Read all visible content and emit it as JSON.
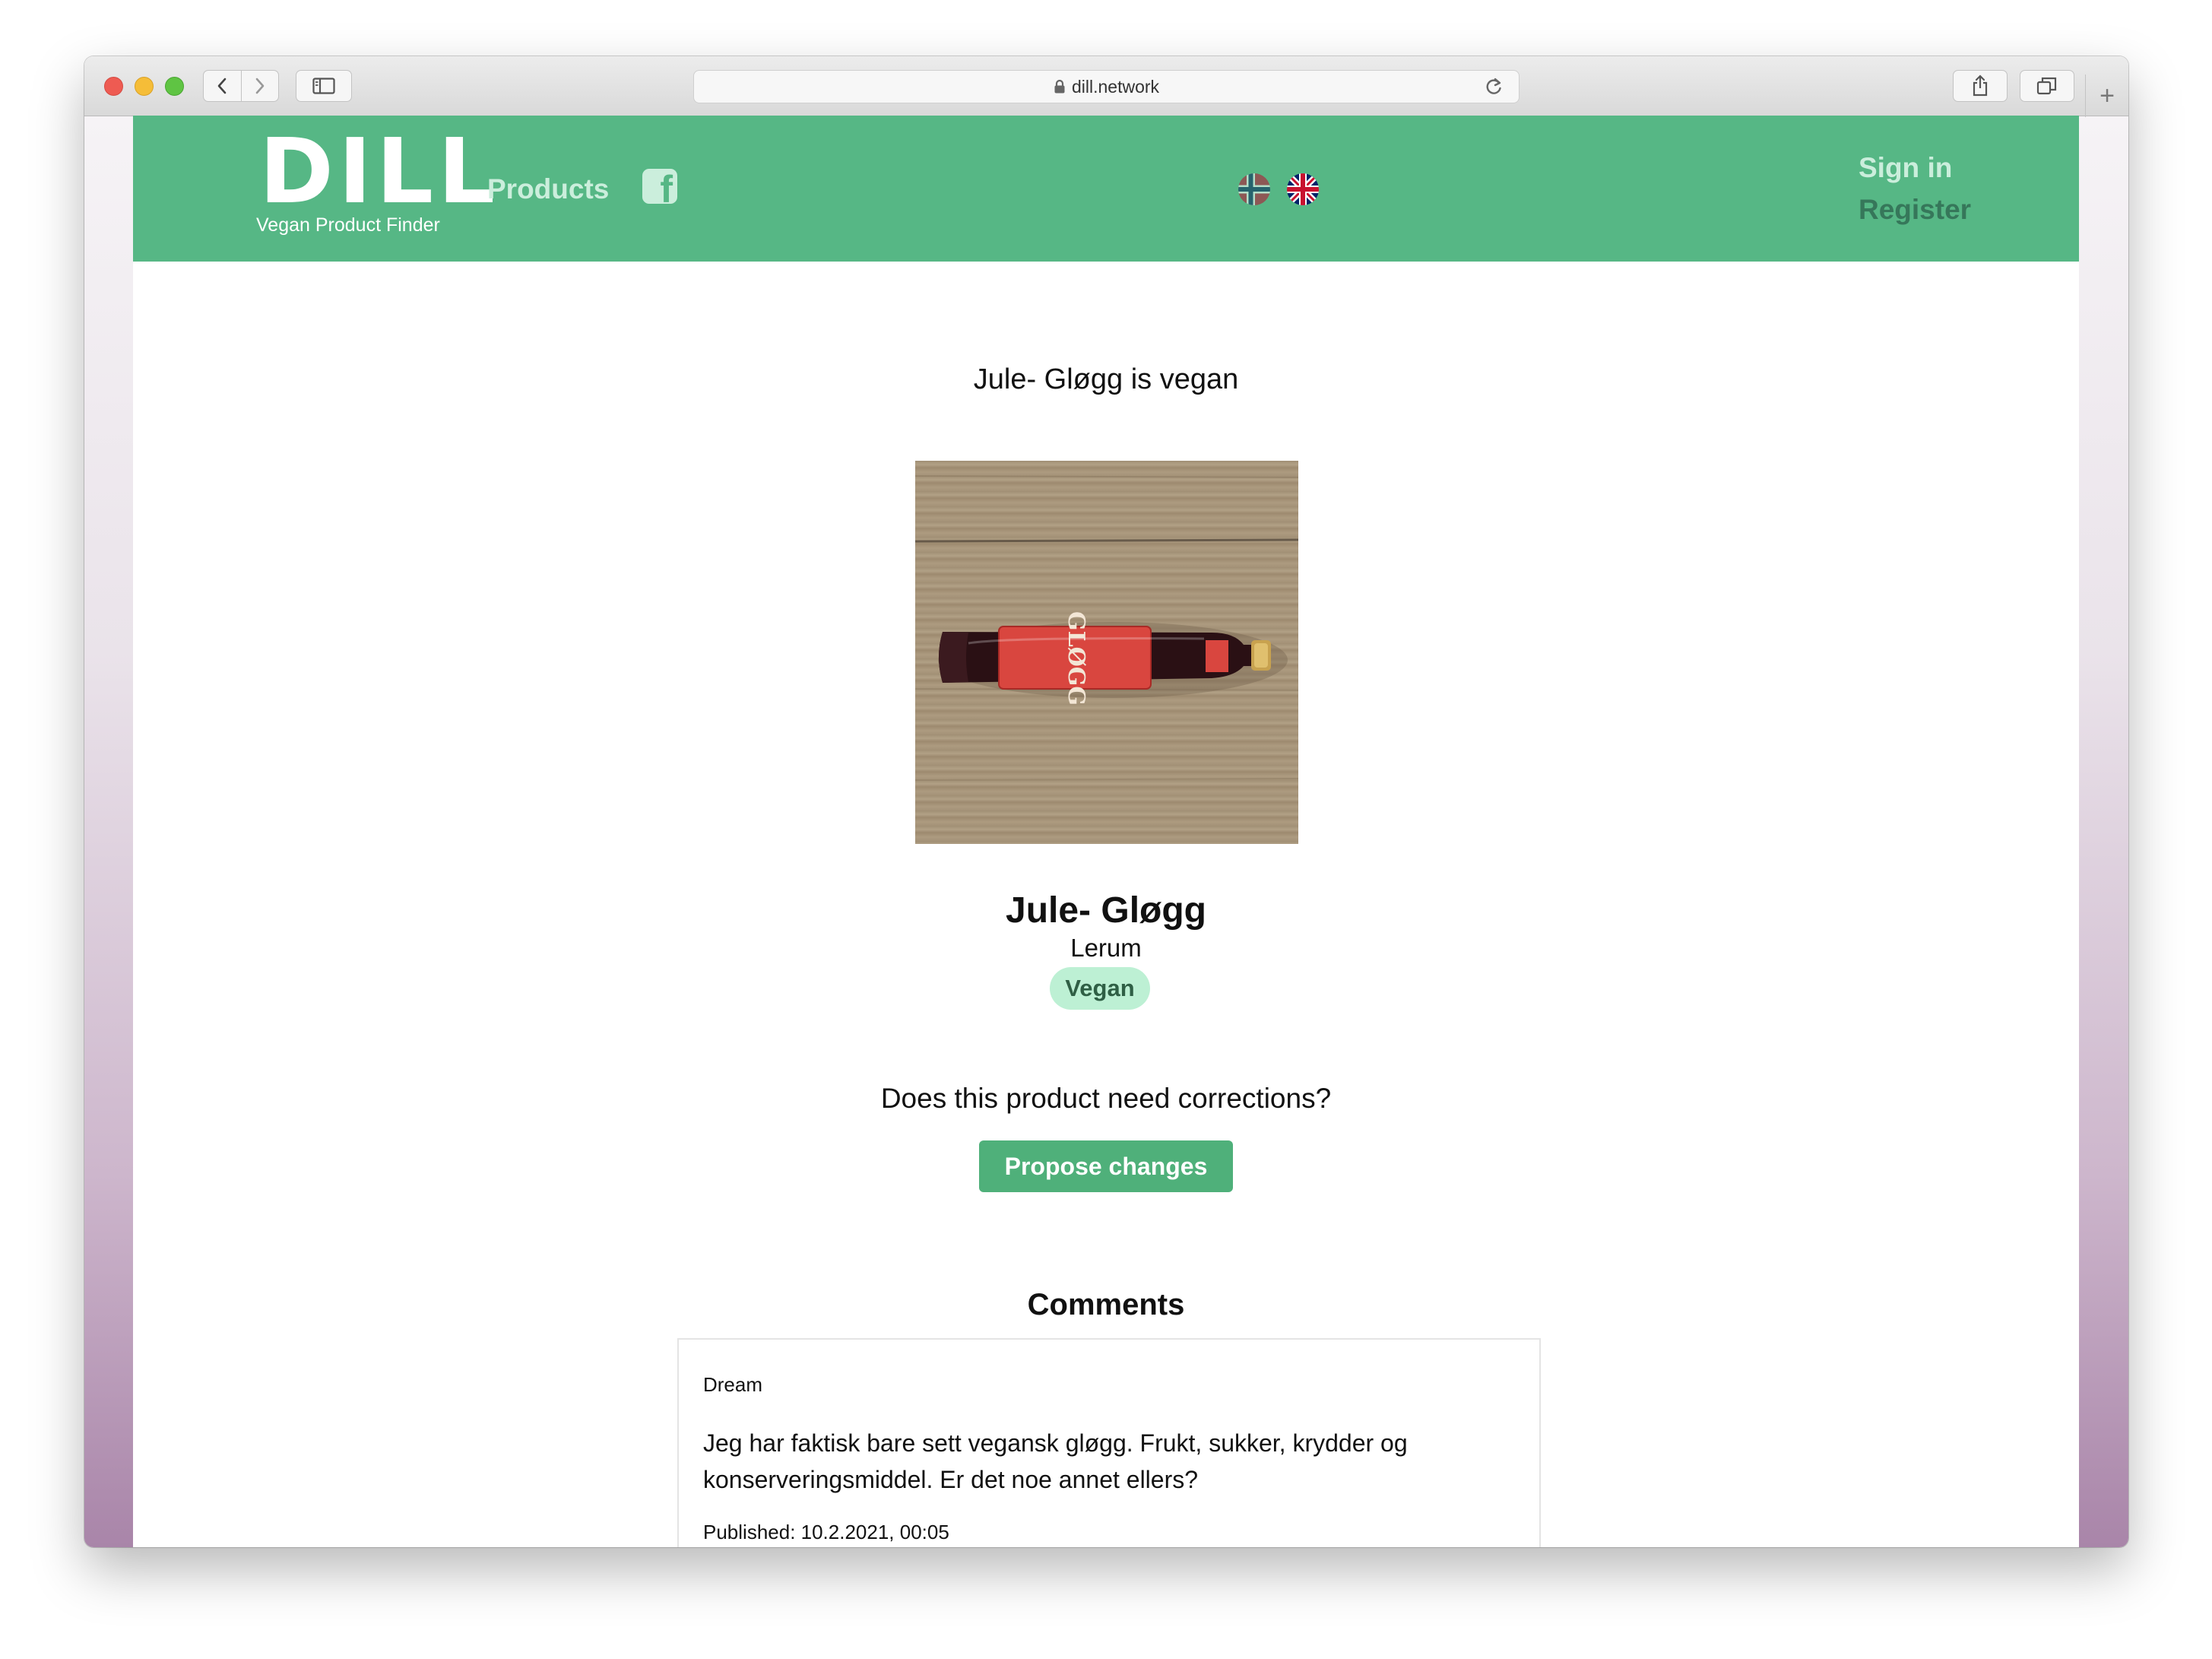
{
  "browser": {
    "url": "dill.network"
  },
  "navbar": {
    "logo_text": "DILL",
    "logo_subtitle": "Vegan Product Finder",
    "products_label": "Products",
    "social_icon": "facebook-icon",
    "languages": [
      "norwegian-flag-icon",
      "uk-flag-icon"
    ],
    "signin_label": "Sign in",
    "register_label": "Register",
    "bg_color": "#56b785"
  },
  "product": {
    "headline": "Jule- Gløgg is vegan",
    "name": "Jule- Gløgg",
    "brand": "Lerum",
    "badge": "Vegan",
    "image_alt": "Product photo"
  },
  "corrections": {
    "question": "Does this product need corrections?",
    "button_label": "Propose changes"
  },
  "comments": {
    "title": "Comments",
    "items": [
      {
        "author": "Dream",
        "text": "Jeg har faktisk bare sett vegansk gløgg. Frukt, sukker, krydder og konserveringsmiddel. Er det noe annet ellers?",
        "published": "Published: 10.2.2021, 00:05"
      }
    ]
  },
  "colors": {
    "accent": "#56b785",
    "badge_bg": "#bdf0d4",
    "button_bg": "#4fb07a"
  }
}
